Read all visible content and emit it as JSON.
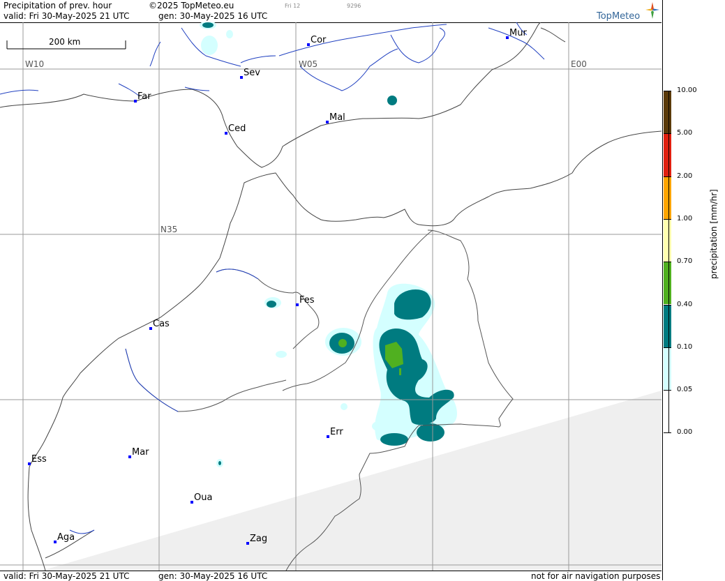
{
  "header": {
    "title": "Precipitation of prev. hour",
    "copyright": "©2025 TopMeteo.eu",
    "valid": "valid:  Fri  30-May-2025  21 UTC",
    "gen": "gen: 30-May-2025 16 UTC",
    "tiny1": "Fri 12",
    "tiny2": "9296",
    "brand": "TopMeteo"
  },
  "footer": {
    "valid": "valid:  Fri  30-May-2025  21 UTC",
    "gen": "gen: 30-May-2025 16 UTC",
    "note": "not for air navigation purposes"
  },
  "map": {
    "scale_label": "200 km",
    "grid_labels": {
      "w10": "W10",
      "w05": "W05",
      "e00": "E00",
      "n35": "N35"
    },
    "cities": [
      {
        "name": "Cor"
      },
      {
        "name": "Mur"
      },
      {
        "name": "Sev"
      },
      {
        "name": "Far"
      },
      {
        "name": "Mal"
      },
      {
        "name": "Ced"
      },
      {
        "name": "Fes"
      },
      {
        "name": "Cas"
      },
      {
        "name": "Err"
      },
      {
        "name": "Ess"
      },
      {
        "name": "Mar"
      },
      {
        "name": "Oua"
      },
      {
        "name": "Aga"
      },
      {
        "name": "Zag"
      }
    ]
  },
  "legend": {
    "label": "precipitation [mm/hr]",
    "levels": [
      {
        "value": "10.00",
        "color": "#5a3a0a"
      },
      {
        "value": "5.00",
        "color": "#e02010"
      },
      {
        "value": "2.00",
        "color": "#ffa500"
      },
      {
        "value": "1.00",
        "color": "#ffffb0"
      },
      {
        "value": "0.70",
        "color": "#50b020"
      },
      {
        "value": "0.40",
        "color": "#007b80"
      },
      {
        "value": "0.10",
        "color": "#d4ffff"
      },
      {
        "value": "0.05",
        "color": "#ffffff"
      },
      {
        "value": "0.00",
        "color": "#ffffff"
      }
    ]
  },
  "colors": {
    "light": "#d4ffff",
    "teal": "#007b80",
    "green": "#50b020",
    "nodata": "#efefef",
    "grid": "#999999",
    "city": "#0000ff"
  }
}
